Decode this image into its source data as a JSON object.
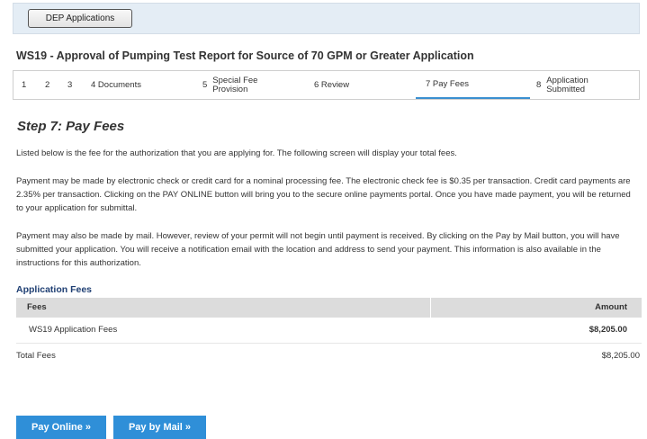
{
  "topbar": {
    "button_label": "DEP Applications"
  },
  "title": "WS19 - Approval of Pumping Test Report for Source of 70 GPM or Greater Application",
  "steps": [
    {
      "label": "1"
    },
    {
      "label": "2"
    },
    {
      "label": "3"
    },
    {
      "label": "4 Documents"
    },
    {
      "num": "5",
      "line1": "Special Fee",
      "line2": "Provision"
    },
    {
      "label": "6 Review"
    },
    {
      "label": "7 Pay Fees",
      "active": true
    },
    {
      "num": "8",
      "line1": "Application",
      "line2": "Submitted"
    }
  ],
  "heading": "Step 7: Pay Fees",
  "para1": "Listed below is the fee for the authorization that you are applying for. The following screen will display your total fees.",
  "para2": "Payment may be made by electronic check or credit card for a nominal processing fee. The electronic check fee is $0.35 per transaction. Credit card payments are 2.35% per transaction. Clicking on the PAY ONLINE button will bring you to the secure online payments portal. Once you have made payment, you will be returned to your application for submittal.",
  "para3": "Payment may also be made by mail. However, review of your permit will not begin until payment is received. By clicking on the Pay by Mail button, you will have submitted your application. You will receive a notification email with the location and address to send your payment. This information is also available in the instructions for this authorization.",
  "fees": {
    "heading": "Application Fees",
    "col_fees": "Fees",
    "col_amount": "Amount",
    "rows": [
      {
        "name": "WS19 Application Fees",
        "amount": "$8,205.00"
      }
    ],
    "total_label": "Total Fees",
    "total_amount": "$8,205.00"
  },
  "buttons": {
    "pay_online": "Pay Online »",
    "pay_mail": "Pay by Mail »"
  },
  "colors": {
    "accent": "#2f8fd8",
    "topbar": "#e4edf5",
    "table_header": "#dcdcdc",
    "heading_blue": "#1f3f73"
  }
}
